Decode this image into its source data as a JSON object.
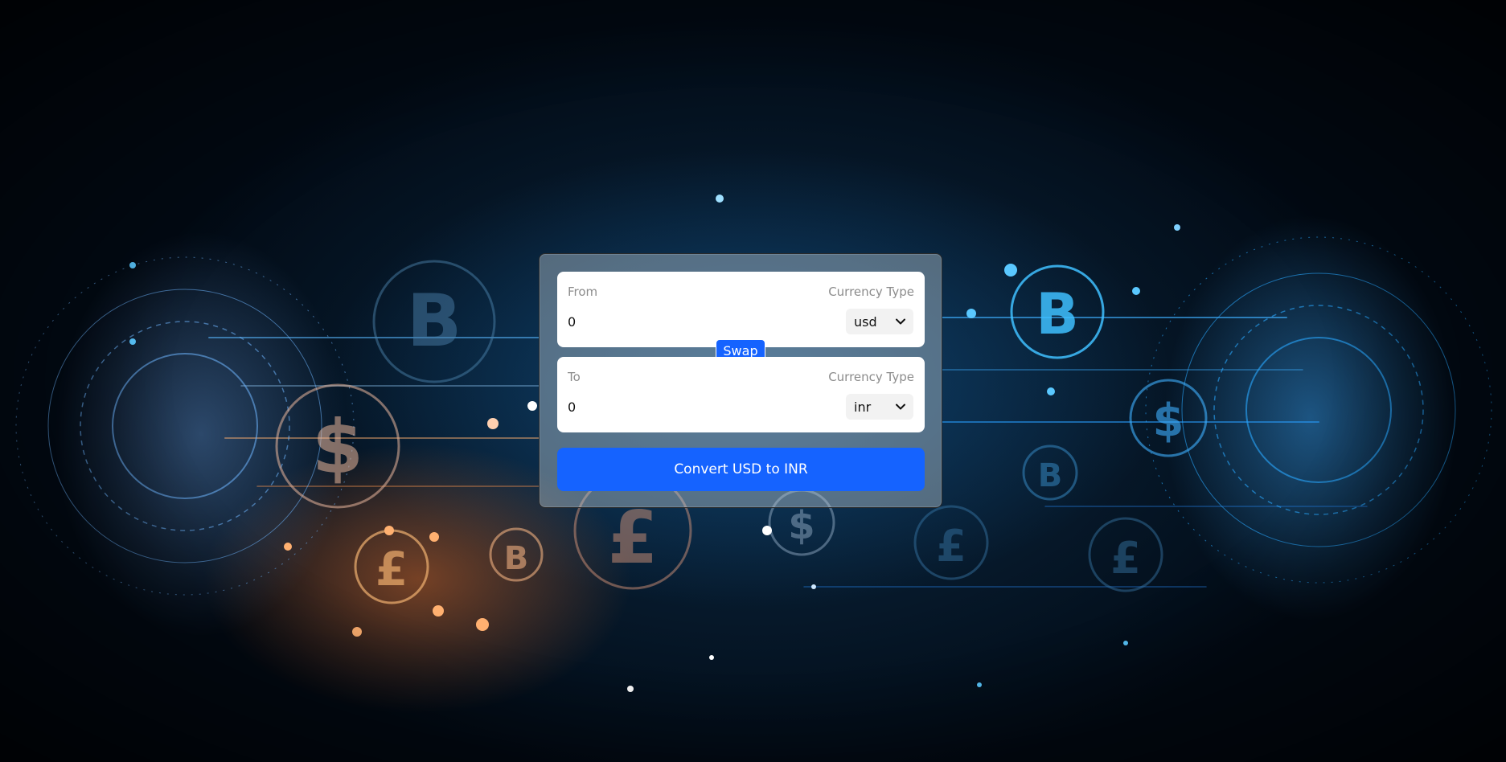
{
  "converter": {
    "from": {
      "label": "From",
      "currency_type_label": "Currency Type",
      "amount": "0",
      "currency": "usd"
    },
    "to": {
      "label": "To",
      "currency_type_label": "Currency Type",
      "amount": "0",
      "currency": "inr"
    },
    "swap_label": "Swap",
    "convert_label": "Convert USD to INR"
  },
  "colors": {
    "accent": "#1563ff",
    "panel": "#ffffff",
    "muted_text": "#8c8c8c"
  },
  "icons": {
    "select_chevron": "chevron-down-icon"
  }
}
